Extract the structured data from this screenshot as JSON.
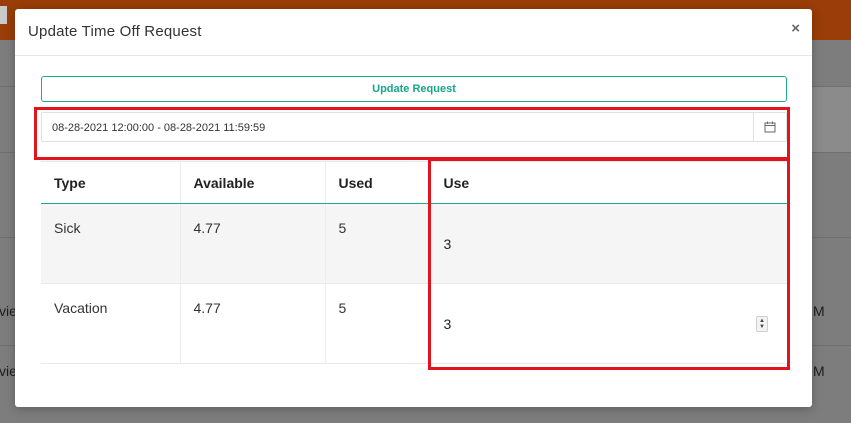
{
  "background": {
    "row_fragment_1": "vie",
    "row_fragment_2": "vie",
    "right_fragment_1": "M",
    "right_fragment_2": "M"
  },
  "modal": {
    "title": "Update Time Off Request",
    "close_label": "×",
    "update_button_label": "Update Request",
    "date_range_value": "08-28-2021 12:00:00 - 08-28-2021 11:59:59",
    "calendar_icon": "calendar-icon"
  },
  "table": {
    "headers": [
      "Type",
      "Available",
      "Used",
      "Use"
    ],
    "rows": [
      {
        "type": "Sick",
        "available": "4.77",
        "used": "5",
        "use": "3"
      },
      {
        "type": "Vacation",
        "available": "4.77",
        "used": "5",
        "use": "3"
      }
    ]
  },
  "colors": {
    "accent": "#20a98f",
    "annotation_red": "#e0151b",
    "topbar": "#9a3d08"
  }
}
